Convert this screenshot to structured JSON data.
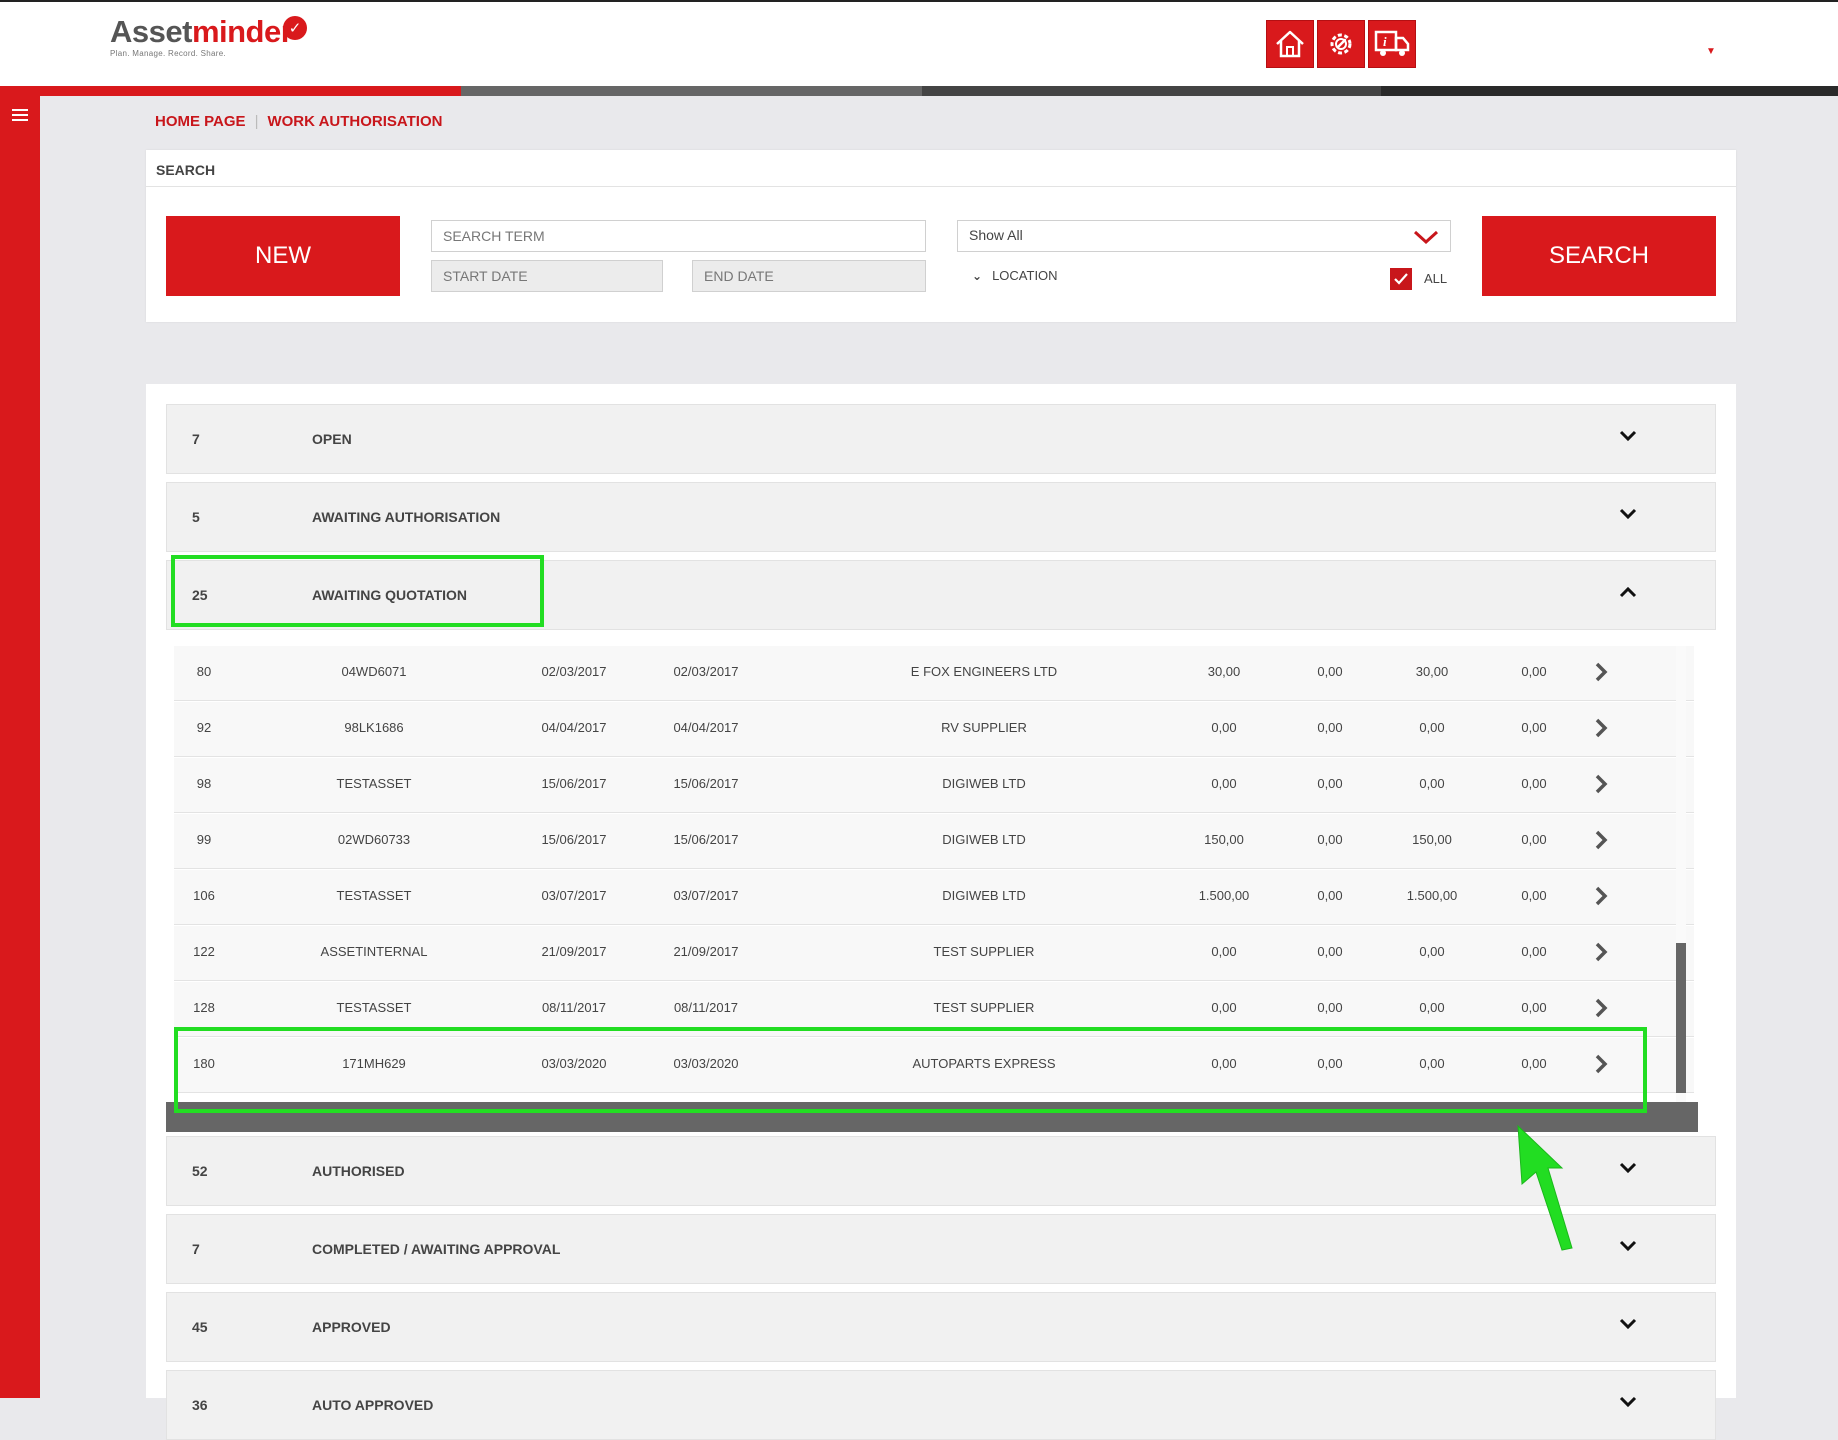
{
  "header": {
    "logo_part1": "Asset",
    "logo_part2": "minder",
    "logo_tagline": "Plan. Manage. Record. Share.",
    "brand_color": "#d9191c",
    "nav_icons": [
      "home-icon",
      "settings-icon",
      "truck-info-icon"
    ]
  },
  "breadcrumb": {
    "home": "HOME PAGE",
    "current": "WORK AUTHORISATION"
  },
  "search": {
    "title": "SEARCH",
    "new_label": "NEW",
    "search_term_placeholder": "SEARCH TERM",
    "start_date_placeholder": "START DATE",
    "end_date_placeholder": "END DATE",
    "filter_value": "Show All",
    "location_label": "LOCATION",
    "all_label": "ALL",
    "all_checked": true,
    "search_label": "SEARCH"
  },
  "groups": [
    {
      "count": "7",
      "label": "OPEN",
      "expanded": false
    },
    {
      "count": "5",
      "label": "AWAITING AUTHORISATION",
      "expanded": false
    },
    {
      "count": "25",
      "label": "AWAITING QUOTATION",
      "expanded": true
    },
    {
      "count": "52",
      "label": "AUTHORISED",
      "expanded": false
    },
    {
      "count": "7",
      "label": "COMPLETED / AWAITING APPROVAL",
      "expanded": false
    },
    {
      "count": "45",
      "label": "APPROVED",
      "expanded": false
    },
    {
      "count": "36",
      "label": "AUTO APPROVED",
      "expanded": false
    }
  ],
  "rows": [
    [
      "80",
      "04WD6071",
      "02/03/2017",
      "02/03/2017",
      "E FOX ENGINEERS LTD",
      "30,00",
      "0,00",
      "30,00",
      "0,00"
    ],
    [
      "92",
      "98LK1686",
      "04/04/2017",
      "04/04/2017",
      "RV SUPPLIER",
      "0,00",
      "0,00",
      "0,00",
      "0,00"
    ],
    [
      "98",
      "TESTASSET",
      "15/06/2017",
      "15/06/2017",
      "DIGIWEB LTD",
      "0,00",
      "0,00",
      "0,00",
      "0,00"
    ],
    [
      "99",
      "02WD60733",
      "15/06/2017",
      "15/06/2017",
      "DIGIWEB LTD",
      "150,00",
      "0,00",
      "150,00",
      "0,00"
    ],
    [
      "106",
      "TESTASSET",
      "03/07/2017",
      "03/07/2017",
      "DIGIWEB LTD",
      "1.500,00",
      "0,00",
      "1.500,00",
      "0,00"
    ],
    [
      "122",
      "ASSETINTERNAL",
      "21/09/2017",
      "21/09/2017",
      "TEST SUPPLIER",
      "0,00",
      "0,00",
      "0,00",
      "0,00"
    ],
    [
      "128",
      "TESTASSET",
      "08/11/2017",
      "08/11/2017",
      "TEST SUPPLIER",
      "0,00",
      "0,00",
      "0,00",
      "0,00"
    ],
    [
      "180",
      "171MH629",
      "03/03/2020",
      "03/03/2020",
      "AUTOPARTS EXPRESS",
      "0,00",
      "0,00",
      "0,00",
      "0,00"
    ]
  ],
  "annotation_color": "#22dd22"
}
